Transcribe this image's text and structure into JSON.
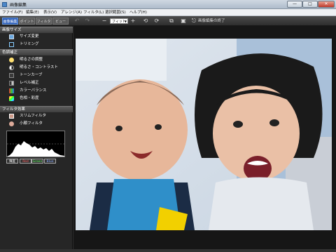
{
  "window": {
    "title": "画像編集",
    "min": "—",
    "max": "□",
    "close": "✕"
  },
  "menu": [
    "ファイル(F)",
    "編集(E)",
    "表示(V)",
    "アレンジ(A)",
    "フィルタ(L)",
    "選択範囲(S)",
    "ヘルプ(H)"
  ],
  "modes": [
    "画像編集",
    "ポイント",
    "フィルタ",
    "ビュー"
  ],
  "toolbar": {
    "zoom": "フィット",
    "exit_label": "画像編集の終了",
    "icons": [
      "undo-icon",
      "redo-icon",
      "zoom-out-icon",
      "zoom-in-icon",
      "rotate-left-icon",
      "rotate-right-icon",
      "crop-icon",
      "save-icon",
      "exit-icon"
    ]
  },
  "sidebar": {
    "size_section": "画像サイズ",
    "size_items": [
      "サイズ変更",
      "トリミング"
    ],
    "color_section": "色調補正",
    "color_items": [
      "明るさの調整",
      "明るさ・コントラスト",
      "トーンカーブ",
      "レベル補正",
      "カラーバランス",
      "色相・彩度"
    ],
    "filter_section": "フィルタ効果",
    "filter_items": [
      "スリムフィルタ",
      "小顔フィルタ"
    ],
    "histogram_buttons": [
      "輝度",
      "Red",
      "Green",
      "Blue"
    ]
  },
  "colors": {
    "accent": "#2a5cb8",
    "panel": "#262626",
    "section": "#4a4a4a"
  }
}
